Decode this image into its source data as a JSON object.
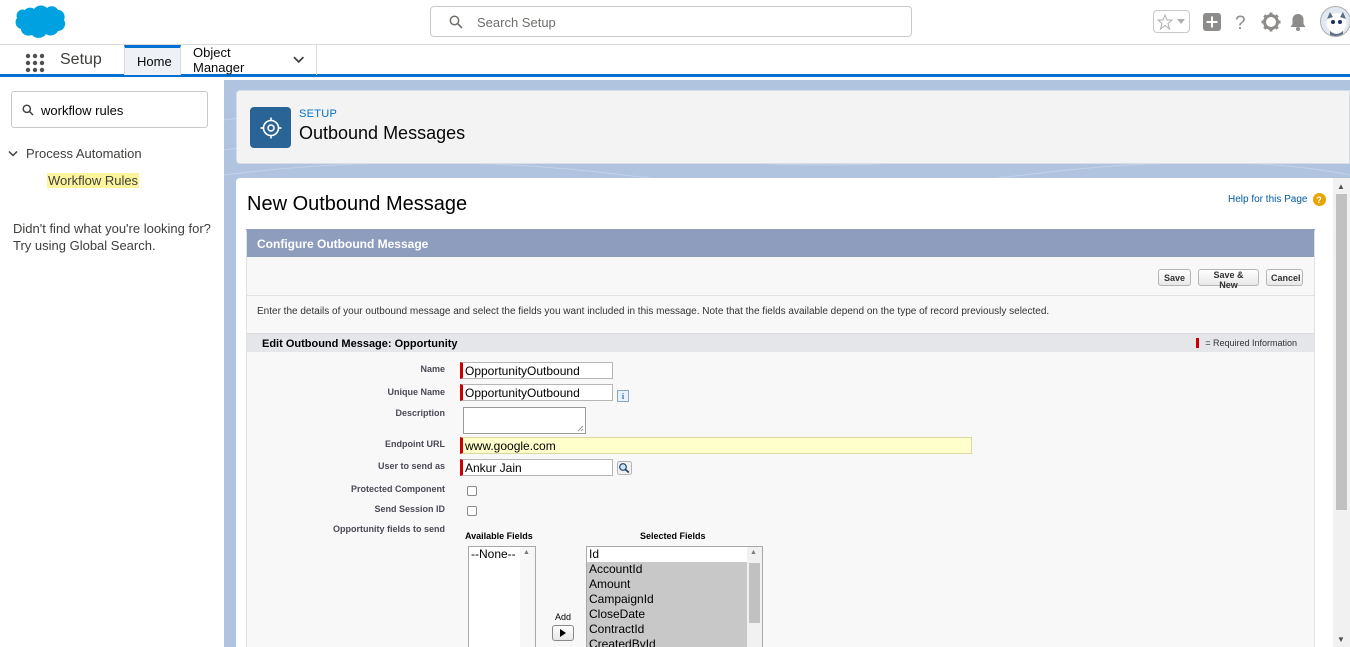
{
  "header": {
    "search_placeholder": "Search Setup",
    "icons": [
      "salesforce-cloud-logo",
      "search-icon",
      "favorites-star-icon",
      "chevron-down-icon",
      "add-plus-icon",
      "help-question-icon",
      "setup-gear-icon",
      "notifications-bell-icon",
      "user-avatar"
    ]
  },
  "nav": {
    "app_name": "Setup",
    "tabs": [
      {
        "label": "Home",
        "active": true
      },
      {
        "label": "Object Manager",
        "dropdown": true
      }
    ]
  },
  "sidebar": {
    "quick_find_value": "workflow rules",
    "tree": {
      "node_label": "Process Automation",
      "leaf_label": "Workflow Rules"
    },
    "not_found_line1": "Didn't find what you're looking for?",
    "not_found_line2": "Try using Global Search."
  },
  "page_header": {
    "super_title": "SETUP",
    "title": "Outbound Messages"
  },
  "content": {
    "h1": "New Outbound Message",
    "help_link": "Help for this Page",
    "block_title": "Configure Outbound Message",
    "buttons": {
      "save": "Save",
      "save_new": "Save & New",
      "cancel": "Cancel"
    },
    "intro": "Enter the details of your outbound message and select the fields you want included in this message. Note that the fields available depend on the type of record previously selected.",
    "section_title": "Edit Outbound Message: Opportunity",
    "required_info": "= Required Information",
    "fields": {
      "name_label": "Name",
      "name_value": "OpportunityOutbound",
      "unique_name_label": "Unique Name",
      "unique_name_value": "OpportunityOutbound",
      "description_label": "Description",
      "endpoint_label": "Endpoint URL",
      "endpoint_value": "www.google.com",
      "user_label": "User to send as",
      "user_value": "Ankur Jain",
      "protected_label": "Protected Component",
      "protected_checked": false,
      "session_label": "Send Session ID",
      "session_checked": false,
      "opp_fields_label": "Opportunity fields to send"
    },
    "available_fields_header": "Available Fields",
    "available_fields": [
      "--None--"
    ],
    "add_label": "Add",
    "selected_fields_header": "Selected Fields",
    "selected_fields": [
      "Id",
      "AccountId",
      "Amount",
      "CampaignId",
      "CloseDate",
      "ContractId",
      "CreatedById"
    ]
  },
  "colors": {
    "brand_blue": "#0070d2",
    "block_header": "#8e9dbe",
    "required_red": "#cc0000",
    "endpoint_highlight": "#ffffcc",
    "search_highlight": "#fdf59b"
  }
}
